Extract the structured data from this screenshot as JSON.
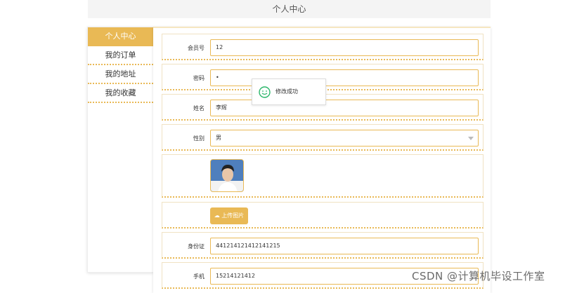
{
  "header": {
    "title": "个人中心"
  },
  "sidebar": {
    "items": [
      {
        "label": "个人中心",
        "active": true
      },
      {
        "label": "我的订单",
        "active": false
      },
      {
        "label": "我的地址",
        "active": false
      },
      {
        "label": "我的收藏",
        "active": false
      }
    ]
  },
  "form": {
    "member_no": {
      "label": "会员号",
      "value": "12"
    },
    "password": {
      "label": "密码",
      "value": "•"
    },
    "name": {
      "label": "姓名",
      "value": "李辉"
    },
    "gender": {
      "label": "性别",
      "value": "男"
    },
    "upload_label": "上传图片",
    "id_card": {
      "label": "身份证",
      "value": "441214121412141215"
    },
    "phone": {
      "label": "手机",
      "value": "15214121412"
    }
  },
  "toast": {
    "message": "修改成功"
  },
  "watermark": "CSDN @计算机毕设工作室",
  "colors": {
    "accent": "#e9b955",
    "success": "#2ab66a"
  }
}
